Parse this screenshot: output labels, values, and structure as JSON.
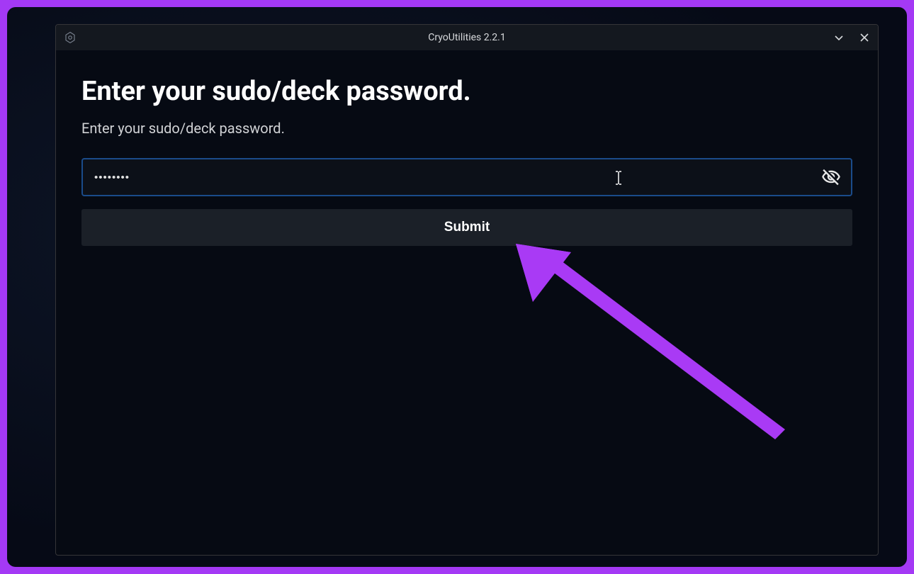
{
  "window": {
    "title": "CryoUtilities 2.2.1"
  },
  "page": {
    "heading": "Enter your sudo/deck password.",
    "subtitle": "Enter your sudo/deck password."
  },
  "form": {
    "password_value": "••••••••",
    "submit_label": "Submit"
  }
}
